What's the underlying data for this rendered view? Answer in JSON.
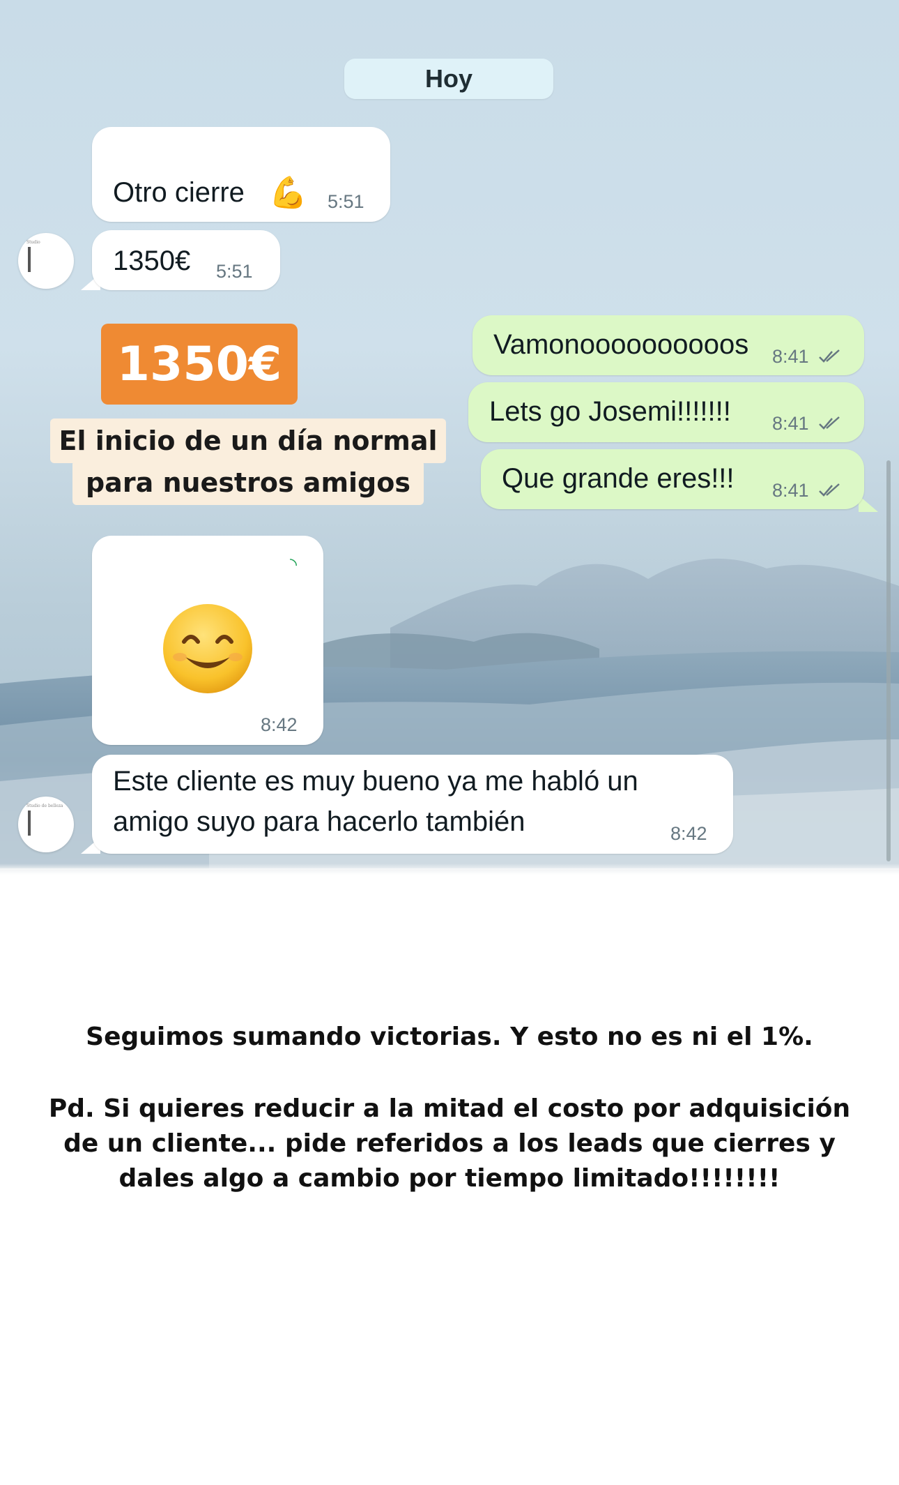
{
  "chat": {
    "date_label": "Hoy",
    "messages": [
      {
        "text": "Otro cierre",
        "emoji": "💪",
        "time": "5:51",
        "direction": "incoming"
      },
      {
        "text": "1350€",
        "time": "5:51",
        "direction": "incoming"
      },
      {
        "text": "Vamonoooooooooos",
        "time": "8:41",
        "direction": "outgoing",
        "status": "read"
      },
      {
        "text": "Lets go Josemi!!!!!!!",
        "time": "8:41",
        "direction": "outgoing",
        "status": "read"
      },
      {
        "text": "Que grande eres!!!",
        "time": "8:41",
        "direction": "outgoing",
        "status": "read"
      },
      {
        "time": "8:42",
        "direction": "incoming",
        "type": "emoji-sticker",
        "emoji": "smiling-face-icon"
      },
      {
        "text_line1": "Este cliente es muy bueno ya me habló un",
        "text_line2": "amigo suyo para hacerlo también",
        "time": "8:42",
        "direction": "incoming"
      }
    ]
  },
  "sticker": {
    "price": "1350€",
    "line1": "El inicio de un día normal",
    "line2": "para nuestros amigos",
    "price_color": "#ef8a33",
    "label_bg": "#faeedd"
  },
  "caption": {
    "line1": "Seguimos sumando victorias. Y esto no es ni el 1%.",
    "line2": "Pd. Si quieres reducir a la mitad el costo por adquisición",
    "line3": "de un cliente... pide referidos a los leads que cierres y",
    "line4": "dales algo a cambio por tiempo limitado!!!!!!!!"
  },
  "colors": {
    "incoming_bubble": "#ffffff",
    "outgoing_bubble": "#dcf8c6",
    "date_pill": "#dff2f8",
    "ticks": "#667781"
  }
}
